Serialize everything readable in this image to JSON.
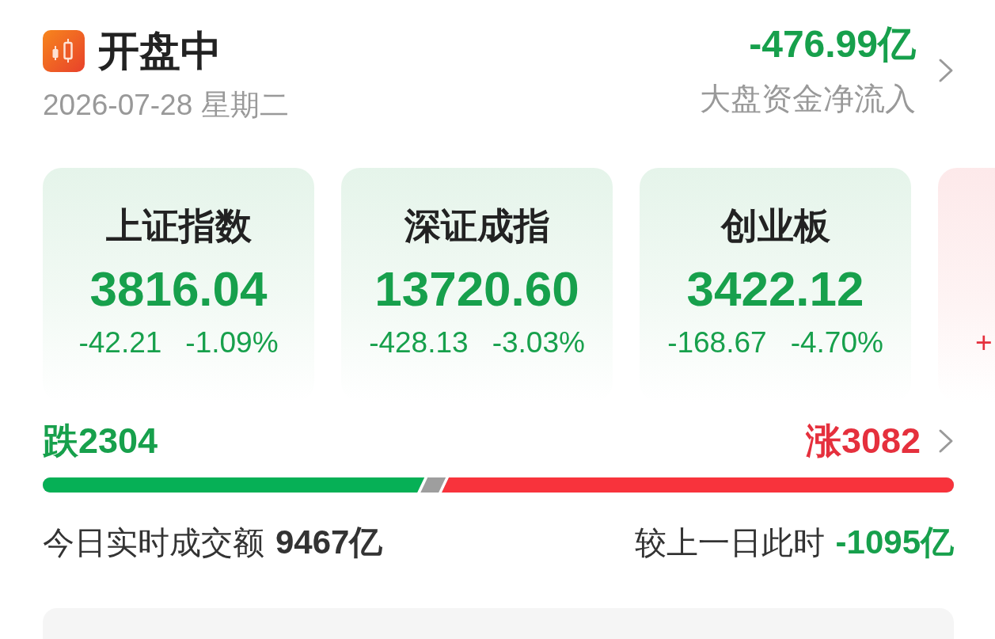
{
  "header": {
    "title": "开盘中",
    "date": "2026-07-28 星期二",
    "net_inflow": {
      "value": "-476.99亿",
      "rising": false,
      "label": "大盘资金净流入"
    }
  },
  "indices": [
    {
      "name": "上证指数",
      "value": "3816.04",
      "change": "-42.21",
      "change_percent": "-1.09%",
      "rising": false
    },
    {
      "name": "深证成指",
      "value": "13720.60",
      "change": "-428.13",
      "change_percent": "-3.03%",
      "rising": false
    },
    {
      "name": "创业板",
      "value": "3422.12",
      "change": "-168.67",
      "change_percent": "-4.70%",
      "rising": false
    },
    {
      "change": "+",
      "rising": true
    }
  ],
  "breadth": {
    "decline": {
      "label": "跌2304",
      "level": 0.419
    },
    "advance": {
      "label": "涨3082",
      "level": 0.562
    }
  },
  "turnover": {
    "label": "今日实时成交额",
    "value": "9467亿",
    "compare_label": "较上一日此时",
    "compare_value": "-1095亿",
    "compare_rising": false
  }
}
